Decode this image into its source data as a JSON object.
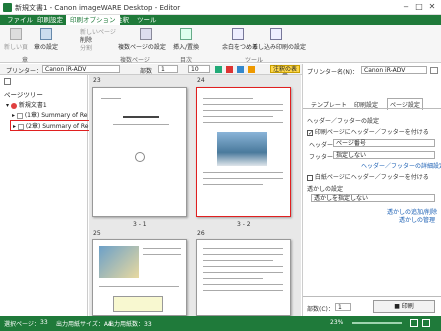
{
  "window": {
    "title": "新規文書1 - Canon imageWARE Desktop - Editor"
  },
  "menu": {
    "items": [
      "ファイル",
      "印刷設定",
      "印刷オプション",
      "注釈",
      "ツール"
    ],
    "active_index": 2
  },
  "ribbon": {
    "new_page": "新しい頁",
    "page_settings": "章の設定",
    "new_page2": "新しいページ",
    "delete": "削除",
    "split": "分割",
    "multi_page_settings": "複数ページの設定",
    "insert_replace": "挿入/置換",
    "fit_to_paper": "余白をつめる",
    "print_settings": "差し込み印刷の設定",
    "group_chapter": "章",
    "group_page": "複数ページ",
    "group_toc": "目次",
    "group_tool": "ツール",
    "page_label": "部数",
    "page_value": "1",
    "zoom_value": "10"
  },
  "printer_bar": {
    "label": "プリンター：",
    "value": "Canon iR-ADV"
  },
  "left_pane": {
    "header": "ページツリー",
    "root": "新規文書1",
    "items": [
      "(1章) Summary of Re",
      "(2章) Summary of Re"
    ]
  },
  "pages": {
    "labels": [
      "23",
      "24",
      "3 - 1",
      "3 - 2",
      "25",
      "26"
    ]
  },
  "right_pane": {
    "printer_label": "プリンター名(N)：",
    "printer_value": "Canon iR-ADV",
    "tabs": [
      "テンプレート",
      "印刷設定",
      "ページ設定"
    ],
    "active_tab": 2,
    "section_header_footer": "ヘッダー／フッターの設定",
    "check_header_footer": "印刷ページにヘッダー／フッターを付ける",
    "header_label": "ヘッダー：",
    "header_value": "ページ番号",
    "footer_label": "フッター：",
    "footer_value": "指定しない",
    "link_details": "ヘッダー／フッターの詳細設定",
    "check_blank": "白紙ページにヘッダー／フッターを付ける",
    "section_watermark": "透かしの設定",
    "watermark_value": "透かしを指定しない",
    "link_add_watermark": "透かしの追加/削除",
    "link_edit_watermark": "透かしの管理",
    "copies_label": "部数(C)：",
    "copies_value": "1",
    "print_button": "印刷",
    "annotation_chip": "注釈の表示"
  },
  "status": {
    "selected_pages": "選択ページ：",
    "selected_value": "33",
    "paper_size": "出力用紙サイズ：A4",
    "paper_count": "出力用紙数：33",
    "zoom": "23%"
  },
  "colors": {
    "accent": "#1f7a3a",
    "selection": "#e02020"
  }
}
